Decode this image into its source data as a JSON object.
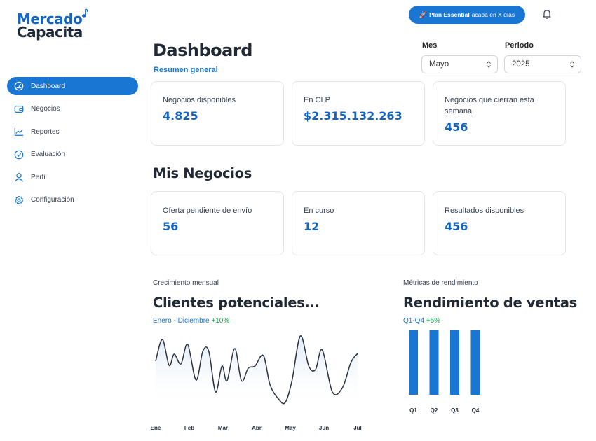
{
  "logo": {
    "line1": "Mercado",
    "line2": "Capacita"
  },
  "topbar": {
    "plan_strong": "Plan Essential",
    "plan_rest": "acaba en X días",
    "plan_icon": "rocket-icon",
    "bell_icon": "bell-icon"
  },
  "sidebar": {
    "items": [
      {
        "label": "Dashboard",
        "icon": "gauge-icon",
        "active": true
      },
      {
        "label": "Negocios",
        "icon": "wallet-icon",
        "active": false
      },
      {
        "label": "Reportes",
        "icon": "line-chart-icon",
        "active": false
      },
      {
        "label": "Evaluación",
        "icon": "check-circle-icon",
        "active": false
      },
      {
        "label": "Perfil",
        "icon": "user-icon",
        "active": false
      },
      {
        "label": "Configuración",
        "icon": "gear-icon",
        "active": false
      }
    ]
  },
  "header": {
    "title": "Dashboard",
    "subtitle": "Resumen general",
    "month_label": "Mes",
    "month_value": "Mayo",
    "period_label": "Periodo",
    "period_value": "2025"
  },
  "summary_cards": [
    {
      "label": "Negocios disponibles",
      "value": "4.825"
    },
    {
      "label": "En CLP",
      "value": "$2.315.132.263"
    },
    {
      "label": "Negocios que cierran esta semana",
      "value": "456"
    }
  ],
  "mis_negocios": {
    "title": "Mis Negocios",
    "cards": [
      {
        "label": "Oferta pendiente de envío",
        "value": "56"
      },
      {
        "label": "En curso",
        "value": "12"
      },
      {
        "label": "Resultados disponibles",
        "value": "456"
      }
    ]
  },
  "growth_chart": {
    "kicker": "Crecimiento mensual",
    "title": "Clientes potenciales...",
    "range": "Enero - Diciembre",
    "delta": "+10%"
  },
  "sales_chart": {
    "kicker": "Métricas de rendimiento",
    "title": "Rendimiento de ventas",
    "range": "Q1-Q4",
    "delta": "+5%"
  },
  "colors": {
    "primary": "#1976d2",
    "value_blue": "#1565c0",
    "positive": "#16a34a",
    "line": "#2b3340"
  },
  "chart_data": [
    {
      "type": "line",
      "categories": [
        "Ene",
        "Feb",
        "Mar",
        "Abr",
        "May",
        "Jun",
        "Jul"
      ],
      "points": [
        [
          0.0,
          0.62
        ],
        [
          0.2,
          0.93
        ],
        [
          0.4,
          0.56
        ],
        [
          0.55,
          0.72
        ],
        [
          0.75,
          0.58
        ],
        [
          0.95,
          0.86
        ],
        [
          1.2,
          0.35
        ],
        [
          1.4,
          0.76
        ],
        [
          1.58,
          0.76
        ],
        [
          1.78,
          0.18
        ],
        [
          1.97,
          0.55
        ],
        [
          2.12,
          0.34
        ],
        [
          2.35,
          0.8
        ],
        [
          2.55,
          0.34
        ],
        [
          2.75,
          0.52
        ],
        [
          2.95,
          0.55
        ],
        [
          3.2,
          0.7
        ],
        [
          3.4,
          0.28
        ],
        [
          3.65,
          0.08
        ],
        [
          3.85,
          0.03
        ],
        [
          4.05,
          0.34
        ],
        [
          4.3,
          0.98
        ],
        [
          4.55,
          0.55
        ],
        [
          4.75,
          0.5
        ],
        [
          4.95,
          0.78
        ],
        [
          5.25,
          0.18
        ],
        [
          5.55,
          0.24
        ],
        [
          5.8,
          0.6
        ],
        [
          6.0,
          0.73
        ]
      ],
      "fill": true
    },
    {
      "type": "bar",
      "categories": [
        "Q1",
        "Q2",
        "Q3",
        "Q4"
      ],
      "values": [
        1,
        1,
        1,
        1
      ],
      "ylim": [
        0,
        1
      ]
    }
  ]
}
